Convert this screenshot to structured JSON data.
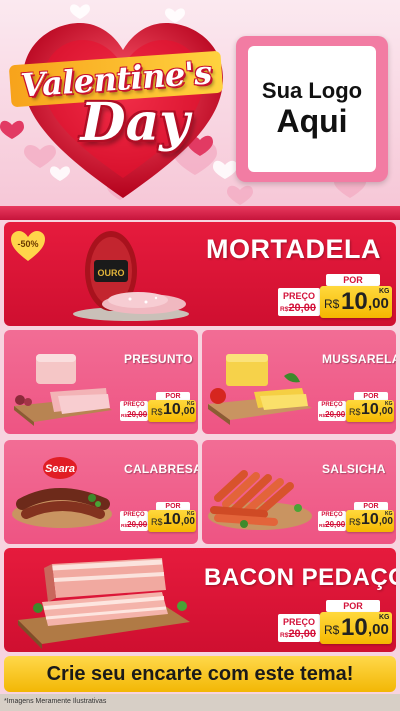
{
  "header": {
    "title_line1": "Valentine's",
    "title_line2": "Day",
    "logo_line1": "Sua Logo",
    "logo_line2": "Aqui"
  },
  "colors": {
    "red": "#d3123a",
    "pink": "#ee5483",
    "yellow": "#ffd93d"
  },
  "products": [
    {
      "name": "MORTADELA",
      "discount": "-50%",
      "por_label": "POR",
      "preco_label": "PREÇO",
      "old_currency": "R$",
      "old_price": "20,00",
      "currency": "R$",
      "price_int": "10",
      "price_dec": ",00",
      "unit": "KG",
      "brand_on_pack": "OURO"
    },
    {
      "name": "PRESUNTO",
      "por_label": "POR",
      "preco_label": "PREÇO",
      "old_currency": "R$",
      "old_price": "20,00",
      "currency": "R$",
      "price_int": "10",
      "price_dec": ",00",
      "unit": "KG"
    },
    {
      "name": "MUSSARELA",
      "por_label": "POR",
      "preco_label": "PREÇO",
      "old_currency": "R$",
      "old_price": "20,00",
      "currency": "R$",
      "price_int": "10",
      "price_dec": ",00",
      "unit": "KG"
    },
    {
      "name": "CALABRESA",
      "por_label": "POR",
      "preco_label": "PREÇO",
      "old_currency": "R$",
      "old_price": "20,00",
      "currency": "R$",
      "price_int": "10",
      "price_dec": ",00",
      "unit": "KG",
      "brand_on_pack": "Seara"
    },
    {
      "name": "SALSICHA",
      "por_label": "POR",
      "preco_label": "PREÇO",
      "old_currency": "R$",
      "old_price": "20,00",
      "currency": "R$",
      "price_int": "10",
      "price_dec": ",00",
      "unit": "KG"
    },
    {
      "name": "BACON PEDAÇO",
      "por_label": "POR",
      "preco_label": "PREÇO",
      "old_currency": "R$",
      "old_price": "20,00",
      "currency": "R$",
      "price_int": "10",
      "price_dec": ",00",
      "unit": "KG"
    }
  ],
  "cta": "Crie seu encarte com este tema!",
  "disclaimer": "*Imagens Meramente Ilustrativas"
}
